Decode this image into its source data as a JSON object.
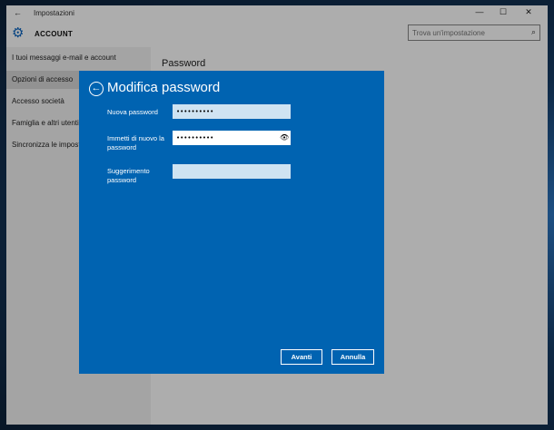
{
  "window": {
    "title": "Impostazioni",
    "back_glyph": "←",
    "min_glyph": "—",
    "max_glyph": "☐",
    "close_glyph": "✕"
  },
  "header": {
    "section": "ACCOUNT",
    "gear_glyph": "⚙",
    "search_placeholder": "Trova un'impostazione",
    "search_glyph": "⌕"
  },
  "sidebar": {
    "items": [
      {
        "label": "I tuoi messaggi e-mail e account"
      },
      {
        "label": "Opzioni di accesso"
      },
      {
        "label": "Accesso società"
      },
      {
        "label": "Famiglia e altri utenti"
      },
      {
        "label": "Sincronizza le impostazioni"
      }
    ]
  },
  "content": {
    "title": "Password"
  },
  "dialog": {
    "title": "Modifica password",
    "back_glyph": "←",
    "fields": {
      "new_password": {
        "label": "Nuova password",
        "value": "••••••••••"
      },
      "repeat_password": {
        "label": "Immetti di nuovo la password",
        "value": "••••••••••"
      },
      "hint": {
        "label": "Suggerimento password",
        "value": ""
      }
    },
    "eye_glyph": "👁",
    "next_label": "Avanti",
    "cancel_label": "Annulla"
  },
  "colors": {
    "dialog_blue": "#0063b1",
    "accent": "#0a64c0",
    "input_pale": "#cfe3f2"
  }
}
